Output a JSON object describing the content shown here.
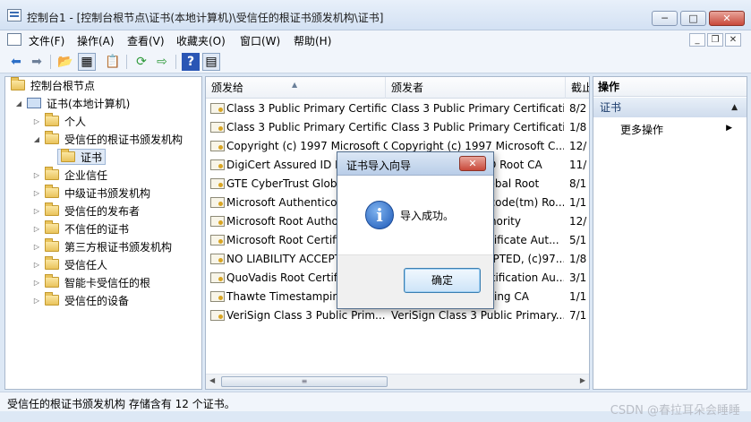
{
  "window": {
    "title": "控制台1 - [控制台根节点\\证书(本地计算机)\\受信任的根证书颁发机构\\证书]",
    "min_label": "─",
    "max_label": "□",
    "close_label": "✕"
  },
  "menu": {
    "items": [
      "文件(F)",
      "操作(A)",
      "查看(V)",
      "收藏夹(O)",
      "窗口(W)",
      "帮助(H)"
    ],
    "mdi_min": "_",
    "mdi_restore": "❐",
    "mdi_close": "✕"
  },
  "toolbar": {
    "icons": [
      "back-arrow-icon",
      "forward-arrow-icon",
      "up-folder-icon",
      "show-hide-tree-icon",
      "properties-icon",
      "refresh-icon",
      "export-list-icon",
      "help-icon",
      "show-hide-action-pane-icon"
    ],
    "glyphs": [
      "⬅",
      "➡",
      "📂",
      "▦",
      "📋",
      "⟳",
      "⇨",
      "?",
      "▤"
    ]
  },
  "tree": {
    "root": "控制台根节点",
    "computer": "证书(本地计算机)",
    "items": [
      {
        "label": "个人",
        "expanded": false
      },
      {
        "label": "受信任的根证书颁发机构",
        "expanded": true
      },
      {
        "label": "证书",
        "selected": true
      },
      {
        "label": "企业信任",
        "expanded": false
      },
      {
        "label": "中级证书颁发机构",
        "expanded": false
      },
      {
        "label": "受信任的发布者",
        "expanded": false
      },
      {
        "label": "不信任的证书",
        "expanded": false
      },
      {
        "label": "第三方根证书颁发机构",
        "expanded": false
      },
      {
        "label": "受信任人",
        "expanded": false
      },
      {
        "label": "智能卡受信任的根",
        "expanded": false
      },
      {
        "label": "受信任的设备",
        "expanded": false
      }
    ]
  },
  "list": {
    "columns": [
      "颁发给",
      "颁发者",
      "截止"
    ],
    "rows": [
      {
        "issued_to": "Class 3 Public Primary Certificat...",
        "issued_by": "Class 3 Public Primary Certificati...",
        "expires": "8/2"
      },
      {
        "issued_to": "Class 3 Public Primary Certificati...",
        "issued_by": "Class 3 Public Primary Certificati...",
        "expires": "1/8"
      },
      {
        "issued_to": "Copyright (c) 1997 Microsoft C...",
        "issued_by": "Copyright (c) 1997 Microsoft C...",
        "expires": "12/"
      },
      {
        "issued_to": "DigiCert Assured ID Root CA",
        "issued_by": "DigiCert Assured ID Root CA",
        "expires": "11/"
      },
      {
        "issued_to": "GTE CyberTrust Global Root",
        "issued_by": "GTE CyberTrust Global Root",
        "expires": "8/1"
      },
      {
        "issued_to": "Microsoft Authenticode(tm) Ro...",
        "issued_by": "Microsoft Authenticode(tm) Ro...",
        "expires": "1/1"
      },
      {
        "issued_to": "Microsoft Root Authority",
        "issued_by": "Microsoft Root Authority",
        "expires": "12/"
      },
      {
        "issued_to": "Microsoft Root Certificate Aut...",
        "issued_by": "Microsoft Root Certificate Aut...",
        "expires": "5/1"
      },
      {
        "issued_to": "NO LIABILITY ACCEPTED, (c)97...",
        "issued_by": "NO LIABILITY ACCEPTED, (c)97...",
        "expires": "1/8"
      },
      {
        "issued_to": "QuoVadis Root Certification Au...",
        "issued_by": "QuoVadis Root Certification Au...",
        "expires": "3/1"
      },
      {
        "issued_to": "Thawte Timestamping CA",
        "issued_by": "Thawte Timestamping CA",
        "expires": "1/1"
      },
      {
        "issued_to": "VeriSign Class 3 Public Prim...",
        "issued_by": "VeriSign Class 3 Public Primary...",
        "expires": "7/1"
      }
    ]
  },
  "actions": {
    "header": "操作",
    "section": "证书",
    "more": "更多操作"
  },
  "status": {
    "text": "受信任的根证书颁发机构 存储含有 12 个证书。"
  },
  "watermark": "CSDN @春拉耳朵会睡睡",
  "dialog": {
    "title": "证书导入向导",
    "close_label": "✕",
    "icon": "info-icon",
    "icon_glyph": "i",
    "message": "导入成功。",
    "ok_label": "确定"
  }
}
